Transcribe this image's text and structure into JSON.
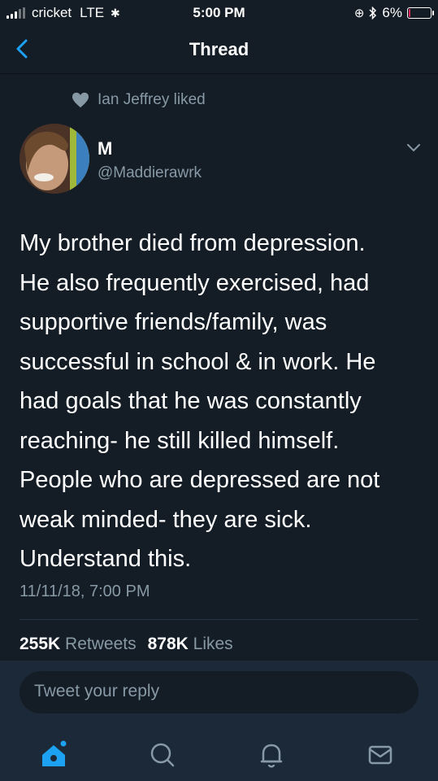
{
  "status_bar": {
    "carrier": "cricket",
    "network": "LTE",
    "time": "5:00 PM",
    "battery": "6%",
    "battery_level": 0.06
  },
  "nav": {
    "title": "Thread"
  },
  "social_context": {
    "text": "Ian Jeffrey liked"
  },
  "tweet": {
    "author_name": "M",
    "author_handle": "@Maddierawrk",
    "text_lines": [
      "My brother died from depression.",
      "He also frequently exercised, had",
      "supportive friends/family, was",
      "successful in school & in work. He",
      "had goals that he was constantly",
      "reaching- he still killed himself.",
      "People who are depressed are not",
      "weak minded- they are sick.",
      "Understand this."
    ],
    "timestamp": "11/11/18, 7:00 PM",
    "retweets_count": "255K",
    "retweets_label": "Retweets",
    "likes_count": "878K",
    "likes_label": "Likes"
  },
  "reply": {
    "placeholder": "Tweet your reply"
  },
  "tabbar": {
    "items": [
      "home-icon",
      "search-icon",
      "notifications-icon",
      "messages-icon"
    ]
  },
  "colors": {
    "background": "#141d26",
    "secondary_text": "#8899a6",
    "accent": "#1da1f2",
    "bar_background": "#1c2938"
  }
}
